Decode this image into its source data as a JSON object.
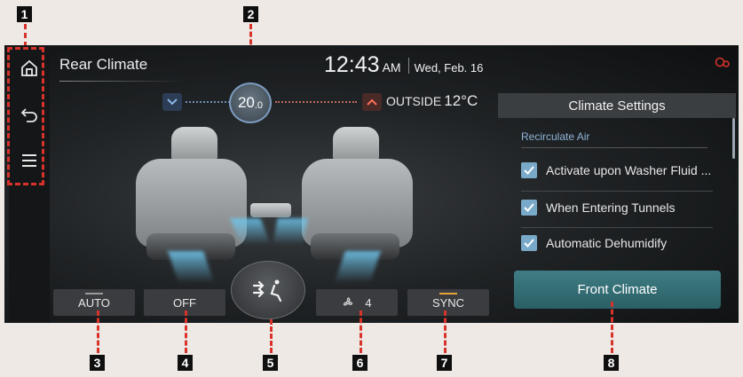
{
  "screen": {
    "title": "Rear Climate",
    "time": "12:43",
    "ampm": "AM",
    "date": "Wed, Feb. 16",
    "status_icon": "connected-car-icon"
  },
  "sidebar": {
    "items": [
      {
        "icon": "home-icon"
      },
      {
        "icon": "back-icon"
      },
      {
        "icon": "menu-icon"
      }
    ]
  },
  "temperature": {
    "value_main": "20",
    "value_decimal": ".0",
    "outside_label": "OUTSIDE",
    "outside_value": "12°C"
  },
  "settings": {
    "header": "Climate Settings",
    "section": "Recirculate Air",
    "options": [
      {
        "label": "Activate upon Washer Fluid ...",
        "checked": true
      },
      {
        "label": "When Entering Tunnels",
        "checked": true
      },
      {
        "label": "Automatic Dehumidify",
        "checked": true
      }
    ]
  },
  "front_climate_label": "Front Climate",
  "buttons": {
    "auto": "AUTO",
    "off": "OFF",
    "fan_speed": "4",
    "sync": "SYNC"
  },
  "markers": [
    "1",
    "2",
    "3",
    "4",
    "5",
    "6",
    "7",
    "8"
  ],
  "colors": {
    "accent_teal": "#2f6d74",
    "marker_red": "#d8332b",
    "check_blue": "#79a9c8",
    "sync_indicator": "#e8a23a"
  }
}
